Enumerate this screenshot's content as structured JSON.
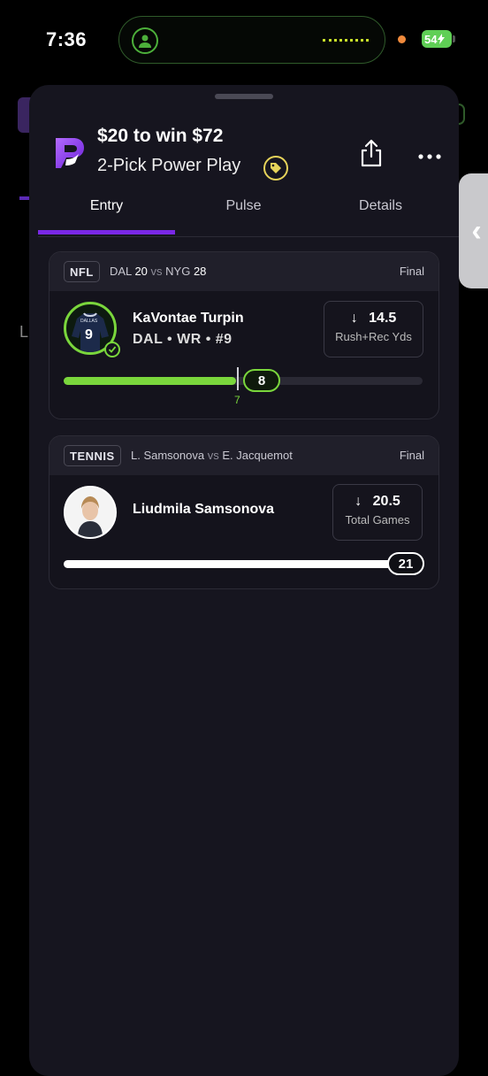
{
  "status_bar": {
    "time": "7:36",
    "battery": "54"
  },
  "entry": {
    "title": "$20 to win $72",
    "subtitle": "2-Pick Power Play",
    "brand_color": "#7a28e6"
  },
  "tabs": [
    {
      "label": "Entry",
      "active": true
    },
    {
      "label": "Pulse",
      "active": false
    },
    {
      "label": "Details",
      "active": false
    }
  ],
  "picks": [
    {
      "league": "NFL",
      "team_a": "DAL",
      "score_a": "20",
      "vs": "vs",
      "team_b": "NYG",
      "score_b": "28",
      "status": "Final",
      "player_name": "KaVontae Turpin",
      "player_info": "DAL • WR • #9",
      "jersey_number": "9",
      "jersey_text": "DALLAS",
      "direction": "↓",
      "line": "14.5",
      "stat": "Rush+Rec Yds",
      "result": "8",
      "tick_label": "7",
      "progress_fraction": 0.48,
      "fill_color": "#7ad63c",
      "outcome": "hit"
    },
    {
      "league": "TENNIS",
      "team_a": "L. Samsonova",
      "vs": "vs",
      "team_b": "E. Jacquemot",
      "status": "Final",
      "player_name": "Liudmila Samsonova",
      "direction": "↓",
      "line": "20.5",
      "stat": "Total Games",
      "result": "21",
      "progress_fraction": 1.0,
      "fill_color": "#ffffff"
    }
  ],
  "icons": [
    "app-logo-icon",
    "tag-icon",
    "share-icon",
    "more-icon",
    "arrow-down-icon",
    "check-icon",
    "chevron-left-icon",
    "person-icon"
  ]
}
